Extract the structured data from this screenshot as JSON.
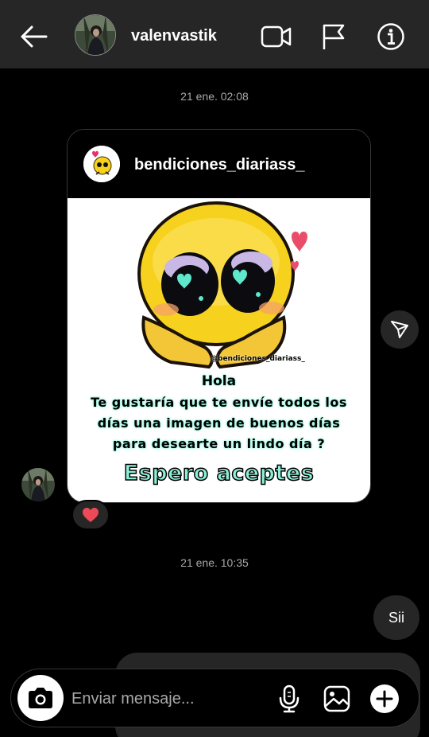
{
  "header": {
    "username": "valenvastik",
    "icons": [
      "back-arrow-icon",
      "video-call-icon",
      "flag-icon",
      "info-icon"
    ]
  },
  "thread": {
    "timestamp_1": "21 ene. 02:08",
    "timestamp_2": "21 ene. 10:35",
    "shared_post": {
      "author": "bendiciones_diariass_",
      "image_watermark": "@bendiciones_diariass_",
      "image_hola": "Hola",
      "image_body_1": "Te gustaría que te envíe todos los",
      "image_body_2": "días una imagen de buenos días",
      "image_body_3": "para desearte un lindo día ?",
      "image_espero": "Espero aceptes"
    },
    "reaction": "❤️",
    "reply": "Sii"
  },
  "composer": {
    "placeholder": "Enviar mensaje...",
    "icons": [
      "camera-icon",
      "microphone-icon",
      "gallery-icon",
      "plus-icon"
    ]
  },
  "colors": {
    "header_bg": "#262626",
    "bubble_bg": "#262626",
    "accent_mint": "#8af0d6",
    "heart": "#ed4956"
  }
}
